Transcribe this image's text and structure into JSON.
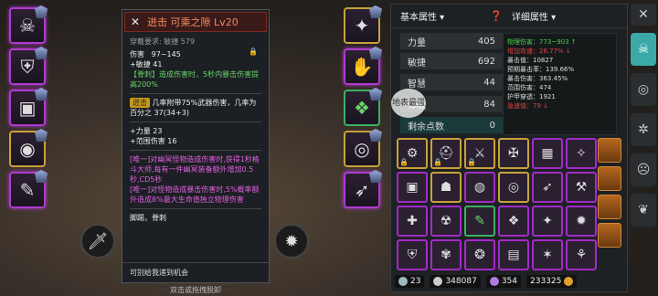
{
  "tooltip": {
    "title": "迸击 可乘之隙 Lv20",
    "req": "穿戴要求: 敏捷 579",
    "damage_label": "伤害",
    "damage_value": "97~145",
    "stat1": "+敏捷 41",
    "effect": "【脊刺】造成伤害时，5秒内暴击伤害提高200%",
    "set_tag": "迸击",
    "set_desc": "几率附带75%武器伤害，几率为百分之 37(34+3)",
    "bonus1": "+力量 23",
    "bonus2": "+范围伤害 16",
    "unique1": "[唯一]对幽冥怪物造成伤害时,获得1秒格斗大师,每有一件幽冥装备额外增加0.5秒,CD5秒",
    "unique2": "[唯一]对怪物造成暴击伤害时,5%概率额外造成8%最大生命值独立物理伤害",
    "tags": "脚踢，脊刺",
    "footer": "可别给我递到机会"
  },
  "bottom_hint": "双击或拖拽脱卸",
  "panel": {
    "tab_basic": "基本属性",
    "tab_detail": "详细属性",
    "stats": [
      {
        "label": "力量",
        "value": "405"
      },
      {
        "label": "敏捷",
        "value": "692"
      },
      {
        "label": "智慧",
        "value": "44"
      },
      {
        "label": "体魄",
        "value": "84"
      },
      {
        "label": "剩余点数",
        "value": "0"
      }
    ],
    "details": [
      {
        "text": "物理伤害：773~903 ↑",
        "color": "#4ad04a"
      },
      {
        "text": "增加攻速：26.77% ↓",
        "color": "#e04040"
      },
      {
        "text": "暴击值：10827",
        "color": "#ddd"
      },
      {
        "text": "预期暴击率：139.66%",
        "color": "#ddd"
      },
      {
        "text": "暴击伤害：363.45%",
        "color": "#ddd"
      },
      {
        "text": "范围伤害：474",
        "color": "#ddd"
      },
      {
        "text": "护甲穿透：1921",
        "color": "#ddd"
      },
      {
        "text": "急速值：79 ↓",
        "color": "#e04040"
      }
    ],
    "currency": {
      "bolts": "23",
      "silver": "348087",
      "gems": "354",
      "gold": "233325"
    }
  },
  "float_label": "地表最强"
}
